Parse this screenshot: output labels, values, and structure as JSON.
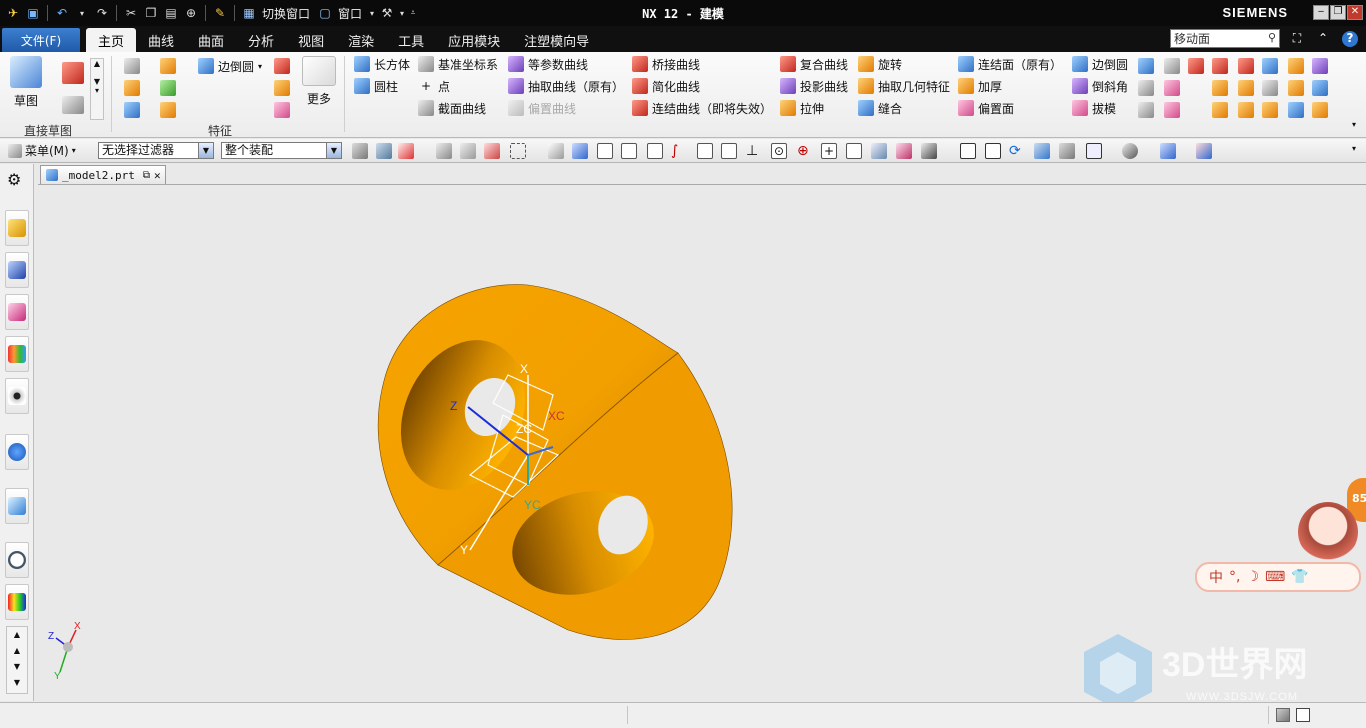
{
  "titlebar": {
    "switch_window_label": "切换窗口",
    "window_menu_label": "窗口",
    "app_title": "NX 12 - 建模",
    "brand": "SIEMENS"
  },
  "tabs": {
    "file_label": "文件(F)",
    "items": [
      {
        "label": "主页",
        "active": true
      },
      {
        "label": "曲线"
      },
      {
        "label": "曲面"
      },
      {
        "label": "分析"
      },
      {
        "label": "视图"
      },
      {
        "label": "渲染"
      },
      {
        "label": "工具"
      },
      {
        "label": "应用模块"
      },
      {
        "label": "注塑模向导"
      }
    ],
    "search_value": "移动面"
  },
  "ribbon": {
    "sketch_group": {
      "big_button": "草图",
      "group_label": "直接草图"
    },
    "feature_group": {
      "edge_blend": "边倒圆",
      "more": "更多",
      "group_label": "特征"
    },
    "col1": [
      "长方体",
      "圆柱"
    ],
    "col2": [
      "基准坐标系",
      "点",
      "截面曲线"
    ],
    "col3": [
      "等参数曲线",
      "抽取曲线（原有）",
      "偏置曲线"
    ],
    "col4": [
      "桥接曲线",
      "简化曲线",
      "连结曲线（即将失效）"
    ],
    "col5": [
      "复合曲线",
      "投影曲线",
      "拉伸"
    ],
    "col6": [
      "旋转",
      "抽取几何特征",
      "缝合"
    ],
    "col7": [
      "连结面（原有）",
      "加厚",
      "偏置面"
    ],
    "col8": [
      "边倒圆",
      "倒斜角",
      "拔模"
    ]
  },
  "selection_bar": {
    "menu_label": "菜单(M)",
    "filter_value": "无选择过滤器",
    "scope_value": "整个装配"
  },
  "document": {
    "tab_label": "_model2.prt"
  },
  "viewport": {
    "model_color": "#f7a500",
    "csys_labels": {
      "x": "X",
      "y": "Y",
      "z": "Z",
      "xc": "XC",
      "yc": "YC",
      "zc": "ZC"
    },
    "triad_labels": {
      "x": "X",
      "y": "Y",
      "z": "Z"
    }
  },
  "ime": {
    "mode_label": "中",
    "badge_value": "85"
  },
  "watermark": {
    "title": "3D世界网",
    "url": "WWW.3DSJW.COM"
  }
}
